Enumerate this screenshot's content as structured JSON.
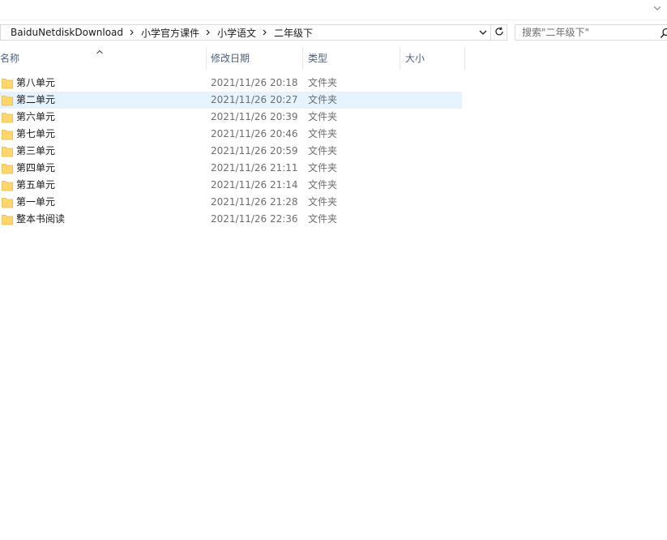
{
  "address": {
    "crumbs": [
      "BaiduNetdiskDownload",
      "小学官方课件",
      "小学语文",
      "二年级下"
    ]
  },
  "search": {
    "placeholder": "搜索\"二年级下\""
  },
  "columns": {
    "name": "名称",
    "date": "修改日期",
    "type": "类型",
    "size": "大小"
  },
  "files": [
    {
      "name": "第八单元",
      "date": "2021/11/26 20:18",
      "type": "文件夹"
    },
    {
      "name": "第二单元",
      "date": "2021/11/26 20:27",
      "type": "文件夹"
    },
    {
      "name": "第六单元",
      "date": "2021/11/26 20:39",
      "type": "文件夹"
    },
    {
      "name": "第七单元",
      "date": "2021/11/26 20:46",
      "type": "文件夹"
    },
    {
      "name": "第三单元",
      "date": "2021/11/26 20:59",
      "type": "文件夹"
    },
    {
      "name": "第四单元",
      "date": "2021/11/26 21:11",
      "type": "文件夹"
    },
    {
      "name": "第五单元",
      "date": "2021/11/26 21:14",
      "type": "文件夹"
    },
    {
      "name": "第一单元",
      "date": "2021/11/26 21:28",
      "type": "文件夹"
    },
    {
      "name": "整本书阅读",
      "date": "2021/11/26 22:36",
      "type": "文件夹"
    }
  ],
  "selected_file": "第二单元",
  "colors": {
    "folder": "#ffd66b",
    "selection": "#e5f3ff",
    "header_text": "#4c607a"
  },
  "icons": {
    "ribbon_toggle": "chevron-down-icon",
    "breadcrumb_separator": "chevron-right-icon",
    "address_dropdown": "chevron-down-icon",
    "refresh": "refresh-icon",
    "search": "search-icon",
    "sort": "sort-ascending-icon",
    "folder": "folder-icon"
  }
}
